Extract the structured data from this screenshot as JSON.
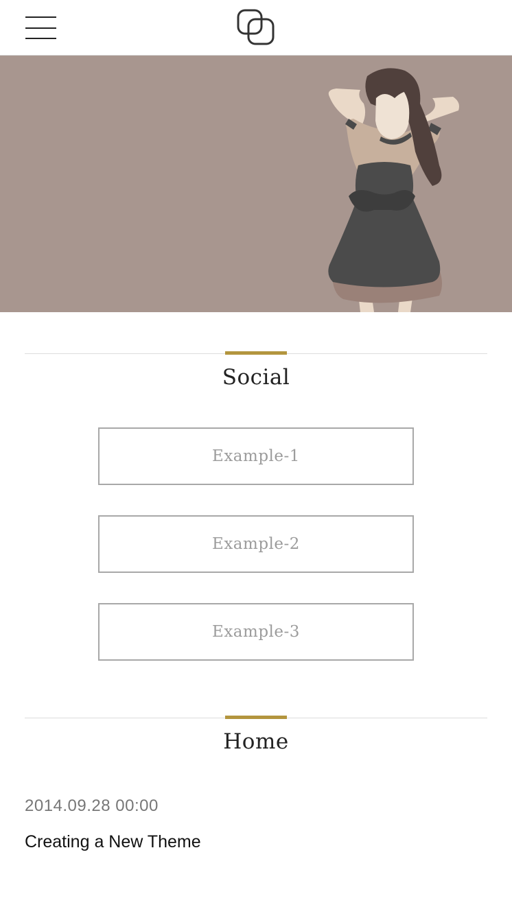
{
  "header": {
    "menu_icon": "hamburger-menu-icon",
    "logo_icon": "overlapping-rounded-squares-logo"
  },
  "hero": {
    "background_color": "#a8968f"
  },
  "social": {
    "title": "Social",
    "buttons": [
      {
        "label": "Example-1"
      },
      {
        "label": "Example-2"
      },
      {
        "label": "Example-3"
      }
    ]
  },
  "home": {
    "title": "Home",
    "posts": [
      {
        "date": "2014.09.28 00:00",
        "title": "Creating a New Theme"
      }
    ]
  },
  "colors": {
    "accent": "#b3953e",
    "rule": "#dcdcdc",
    "button_border": "#a8a8a8",
    "button_text": "#9c9c9c"
  }
}
